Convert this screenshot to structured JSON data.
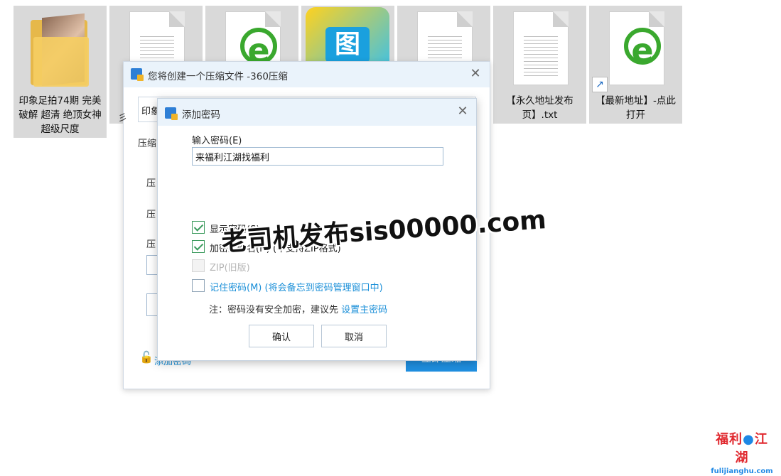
{
  "desktop": {
    "files": [
      {
        "name": "印象足拍74期 完美破解 超清 绝顶女神超级尺度",
        "icon": "folder-icon",
        "selected": true
      },
      {
        "name": "",
        "icon": "text-file-icon"
      },
      {
        "name": "",
        "icon": "ie-shortcut-icon"
      },
      {
        "name": "",
        "icon": "app-icon"
      },
      {
        "name": "",
        "icon": "text-file-icon"
      },
      {
        "name": "【永久地址发布页】.txt",
        "icon": "text-file-icon"
      },
      {
        "name": "【最新地址】-点此打开",
        "icon": "ie-shortcut-icon"
      }
    ]
  },
  "back_dialog": {
    "title": "您将创建一个压缩文件 -360压缩",
    "close_glyph": "✕",
    "field_text": "印象",
    "left_char": "彡",
    "labels": [
      "压缩",
      "压",
      "压",
      "压"
    ],
    "add_password_link": "添加密码",
    "primary_button": "立即压缩"
  },
  "dialog": {
    "title": "添加密码",
    "close_glyph": "✕",
    "password_label": "输入密码(E)",
    "password_value": "来福利江湖找福利",
    "options": [
      {
        "label": "显示密码(S)",
        "checked": true,
        "disabled": false
      },
      {
        "label": "加密文件名(N) (不支持ZIP格式)",
        "checked": true,
        "disabled": false
      },
      {
        "label": "ZIP(旧版)",
        "checked": false,
        "disabled": true
      },
      {
        "label": "记住密码(M) (将会备忘到密码管理窗口中)",
        "checked": false,
        "disabled": false
      }
    ],
    "note_prefix": "注：密码没有安全加密，建议先 ",
    "note_link": "设置主密码",
    "ok_label": "确认",
    "cancel_label": "取消"
  },
  "watermark": {
    "text": "老司机发布sis00000.com",
    "logo_part1": "福利",
    "logo_part2": "江湖",
    "logo_url": "fulijianghu.com"
  },
  "colors": {
    "accent": "#1f8fe0",
    "link": "#1a8fd8",
    "check": "#3a9a5c",
    "titlebar": "#eaf3fb"
  }
}
